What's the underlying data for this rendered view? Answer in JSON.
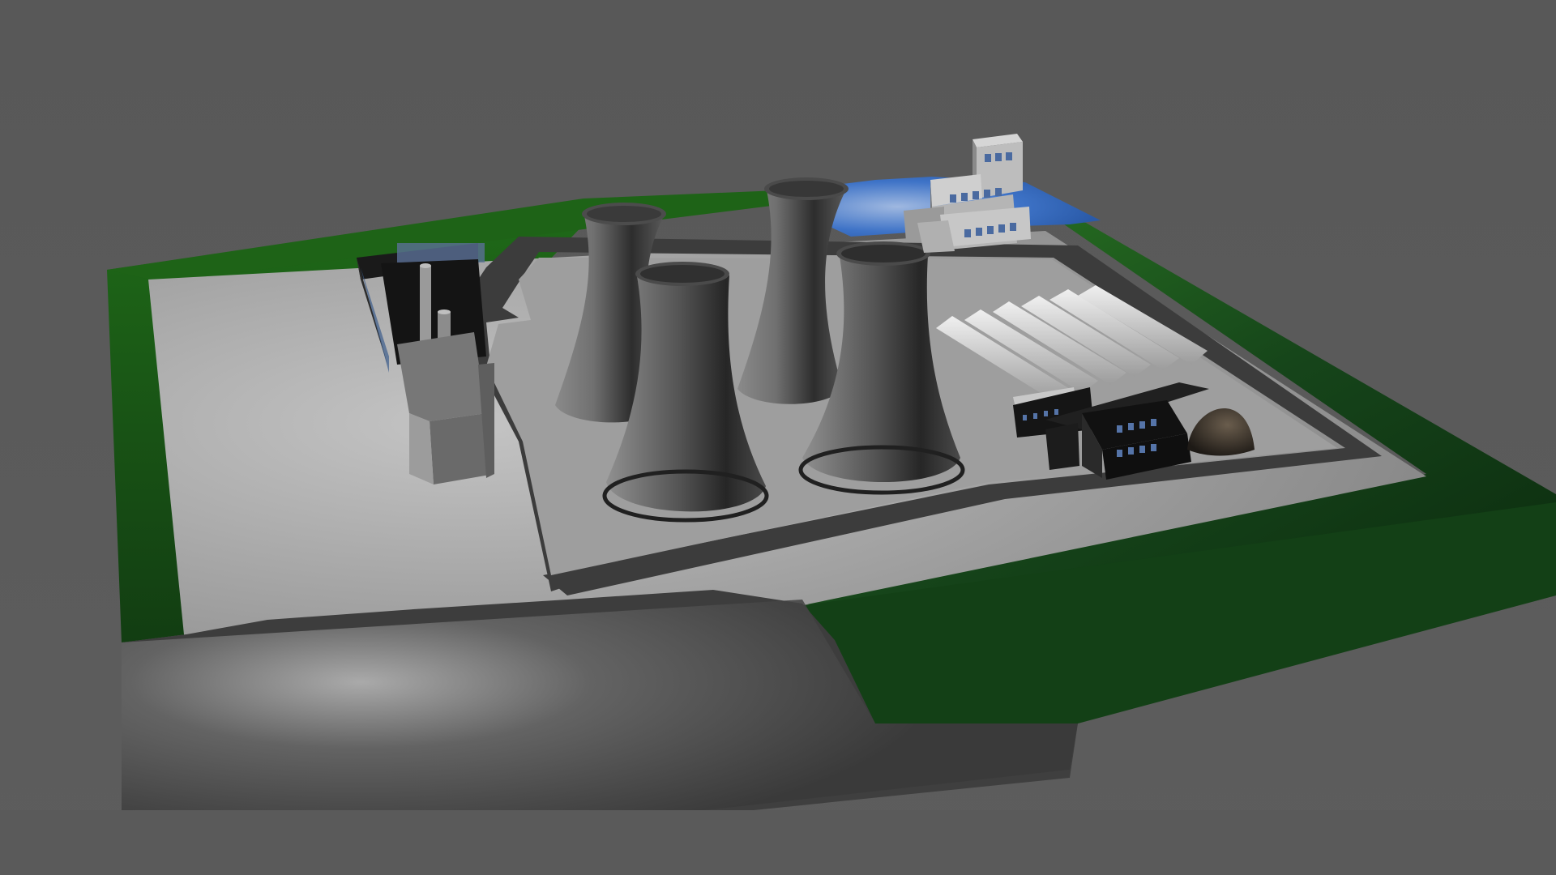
{
  "scene": {
    "description_hidden": "",
    "colors": {
      "background": "#595959",
      "grass": "#1f5a1a",
      "concrete": "#9a9a9a",
      "road": "#3f3f3f",
      "water": "#3d72c8",
      "tower": "#6e6e6e",
      "building_dark": "#111111",
      "building_light": "#a8a8a8",
      "window": "#6f8fbf"
    }
  }
}
